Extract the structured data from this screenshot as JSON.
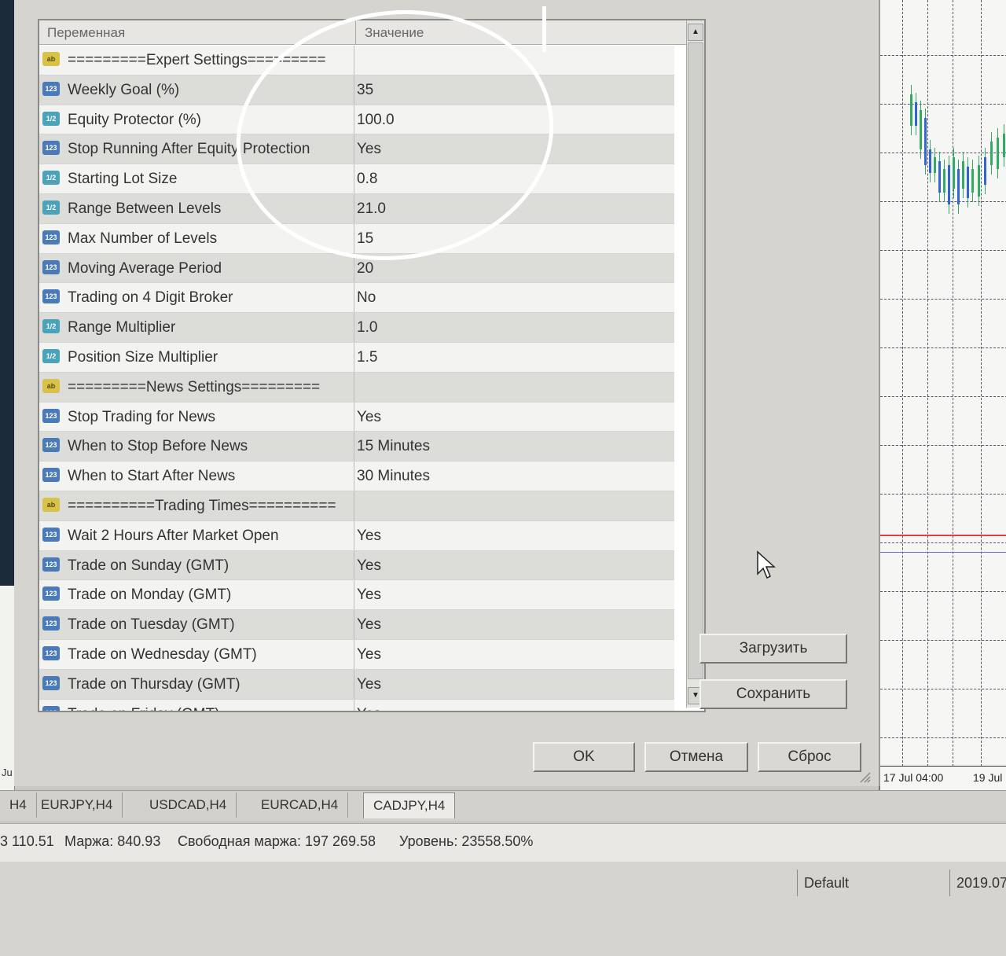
{
  "params_table": {
    "header": {
      "col_variable": "Переменная",
      "col_value": "Значение"
    },
    "rows": [
      {
        "type": "ab",
        "name": "=========Expert Settings=========",
        "value": ""
      },
      {
        "type": "123",
        "name": "Weekly Goal (%)",
        "value": "35"
      },
      {
        "type": "dbl",
        "name": "Equity Protector (%)",
        "value": "100.0"
      },
      {
        "type": "123",
        "name": "Stop Running After Equity Protection",
        "value": "Yes"
      },
      {
        "type": "dbl",
        "name": "Starting Lot Size",
        "value": "0.8"
      },
      {
        "type": "dbl",
        "name": "Range Between Levels",
        "value": "21.0"
      },
      {
        "type": "123",
        "name": "Max Number of Levels",
        "value": "15"
      },
      {
        "type": "123",
        "name": "Moving Average Period",
        "value": "20"
      },
      {
        "type": "123",
        "name": "Trading on 4 Digit Broker",
        "value": "No"
      },
      {
        "type": "dbl",
        "name": "Range Multiplier",
        "value": "1.0"
      },
      {
        "type": "dbl",
        "name": "Position Size Multiplier",
        "value": "1.5"
      },
      {
        "type": "ab",
        "name": "=========News Settings=========",
        "value": ""
      },
      {
        "type": "123",
        "name": "Stop Trading for News",
        "value": "Yes"
      },
      {
        "type": "123",
        "name": "When to Stop Before News",
        "value": "15 Minutes"
      },
      {
        "type": "123",
        "name": "When to Start After News",
        "value": "30 Minutes"
      },
      {
        "type": "ab",
        "name": "==========Trading Times==========",
        "value": ""
      },
      {
        "type": "123",
        "name": "Wait 2 Hours After Market Open",
        "value": "Yes"
      },
      {
        "type": "123",
        "name": "Trade on Sunday (GMT)",
        "value": "Yes"
      },
      {
        "type": "123",
        "name": "Trade on Monday (GMT)",
        "value": "Yes"
      },
      {
        "type": "123",
        "name": "Trade on Tuesday (GMT)",
        "value": "Yes"
      },
      {
        "type": "123",
        "name": "Trade on Wednesday (GMT)",
        "value": "Yes"
      },
      {
        "type": "123",
        "name": "Trade on Thursday (GMT)",
        "value": "Yes"
      },
      {
        "type": "123",
        "name": "Trade on Friday (GMT)",
        "value": "Yes"
      }
    ],
    "type_labels": {
      "ab": "ab",
      "123": "123",
      "dbl": "1/2"
    }
  },
  "buttons": {
    "load": "Загрузить",
    "save": "Сохранить",
    "ok": "OK",
    "cancel": "Отмена",
    "reset": "Сброс"
  },
  "chart": {
    "time_labels": [
      "17 Jul 04:00",
      "19 Jul"
    ],
    "left_fragment": "Ju"
  },
  "tabs": [
    "H4",
    "EURJPY,H4",
    "USDCAD,H4",
    "EURCAD,H4",
    "CADJPY,H4"
  ],
  "active_tab": "CADJPY,H4",
  "status": {
    "balance_fragment": "3 110.51",
    "margin": "Маржа: 840.93",
    "free_margin": "Свободная маржа: 197 269.58",
    "level": "Уровень: 23558.50%"
  },
  "bottom_bar": {
    "profile": "Default",
    "date_fragment": "2019.07"
  },
  "colors": {
    "icon_string": "#d8c24a",
    "icon_int": "#4a7ab8",
    "icon_double": "#4aa3b8",
    "chart_red_line": "#e04040",
    "chart_blue_line": "#6a6ad0"
  }
}
